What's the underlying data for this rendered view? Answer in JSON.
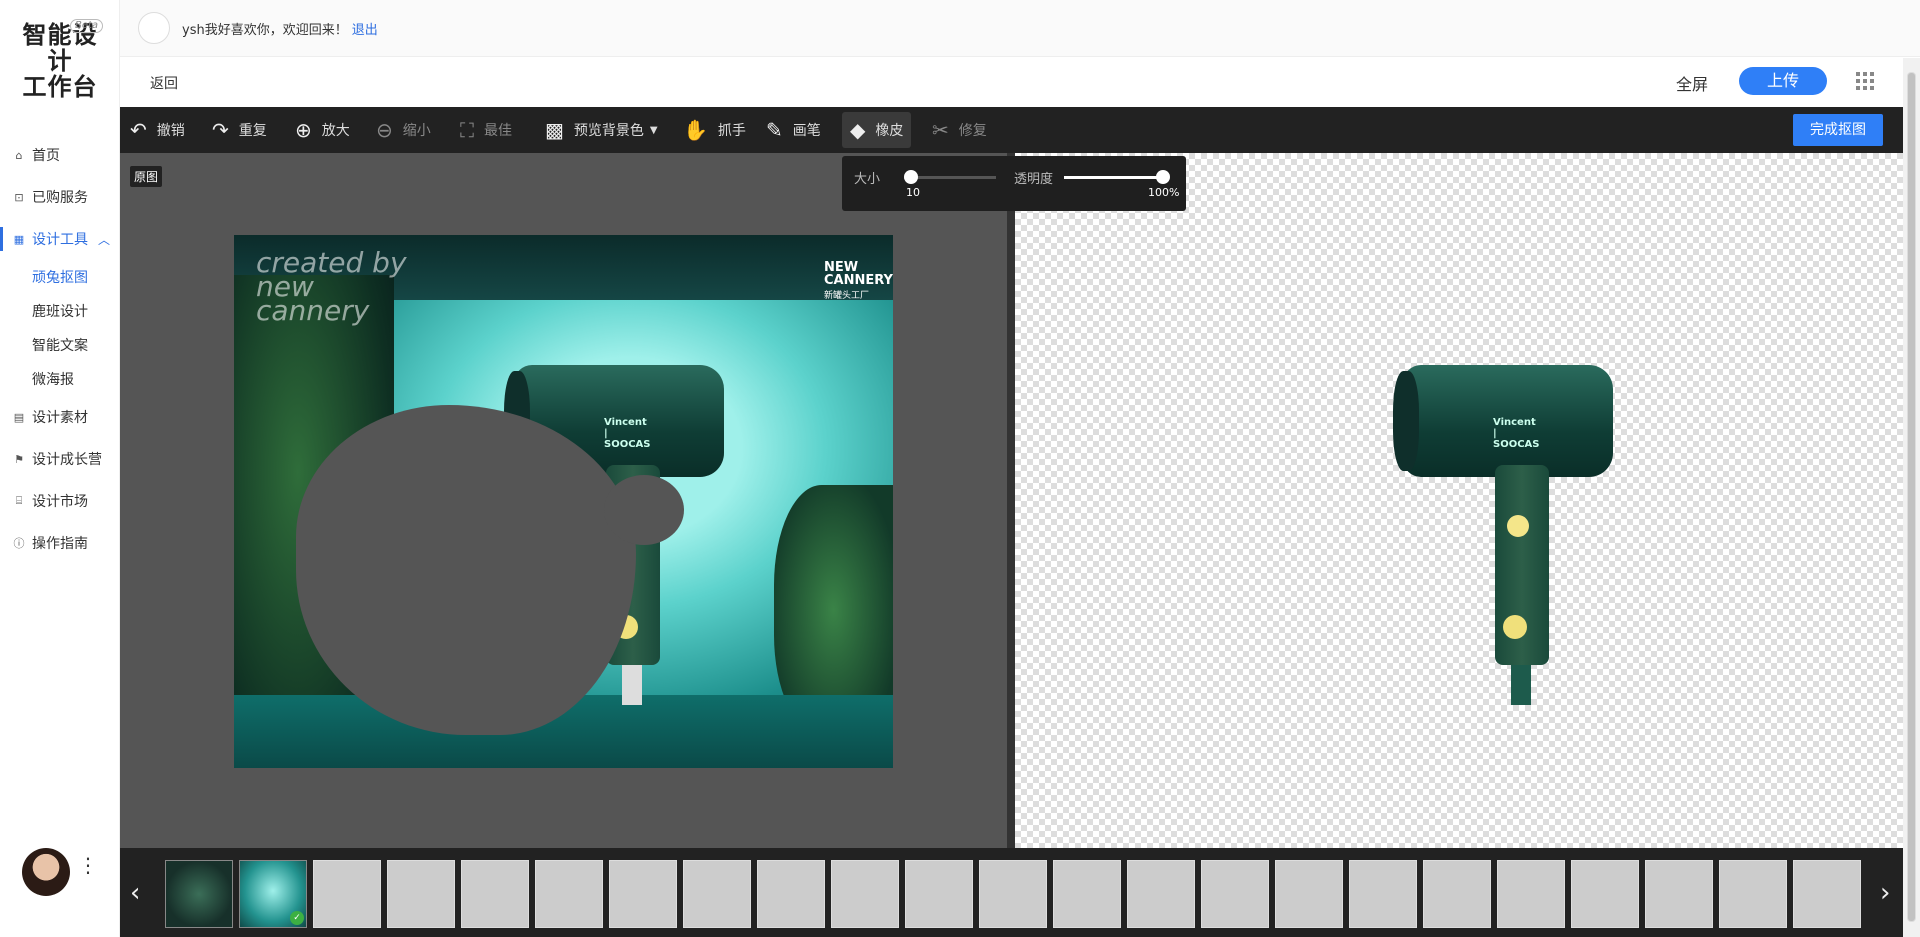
{
  "sidebar": {
    "logo_line1": "智能设计",
    "logo_line2": "工作台",
    "beta": "Beta",
    "nav": [
      {
        "label": "首页",
        "icon": "home-icon"
      },
      {
        "label": "已购服务",
        "icon": "bag-icon"
      },
      {
        "label": "设计工具",
        "icon": "grid-icon",
        "active": true
      },
      {
        "label": "设计素材",
        "icon": "file-icon"
      },
      {
        "label": "设计成长营",
        "icon": "flag-icon"
      },
      {
        "label": "设计市场",
        "icon": "store-icon"
      },
      {
        "label": "操作指南",
        "icon": "help-icon"
      }
    ],
    "subnav": [
      {
        "label": "顽兔抠图",
        "active": true
      },
      {
        "label": "鹿班设计"
      },
      {
        "label": "智能文案"
      },
      {
        "label": "微海报"
      }
    ]
  },
  "topbar": {
    "welcome": "ysh我好喜欢你，欢迎回来！",
    "logout": "退出"
  },
  "header": {
    "back": "返回",
    "fullscreen": "全屏",
    "upload": "上传"
  },
  "toolbar": {
    "tools": [
      {
        "label": "撤销",
        "icon": "undo-icon"
      },
      {
        "label": "重复",
        "icon": "redo-icon"
      },
      {
        "label": "放大",
        "icon": "zoom-in-icon"
      },
      {
        "label": "缩小",
        "icon": "zoom-out-icon"
      },
      {
        "label": "最佳",
        "icon": "fit-icon"
      },
      {
        "label": "预览背景色",
        "icon": "checker-icon"
      },
      {
        "label": "抓手",
        "icon": "hand-icon"
      },
      {
        "label": "画笔",
        "icon": "brush-icon"
      },
      {
        "label": "橡皮",
        "icon": "eraser-icon"
      },
      {
        "label": "修复",
        "icon": "repair-icon"
      }
    ],
    "finish": "完成抠图"
  },
  "canvas": {
    "original_tag": "原图",
    "photo_text": "created by\nnew\ncannery",
    "brand_line1": "NEW",
    "brand_line2": "CANNERY",
    "brand_cn": "新罐头工厂",
    "dryer_label": "Vincent | SOOCAS"
  },
  "brush_popup": {
    "size_label": "大小",
    "size_value": "10",
    "opacity_label": "透明度",
    "opacity_value": "100%"
  },
  "filmstrip": {
    "thumbnail_count": 23,
    "prev": "‹",
    "next": "›"
  }
}
